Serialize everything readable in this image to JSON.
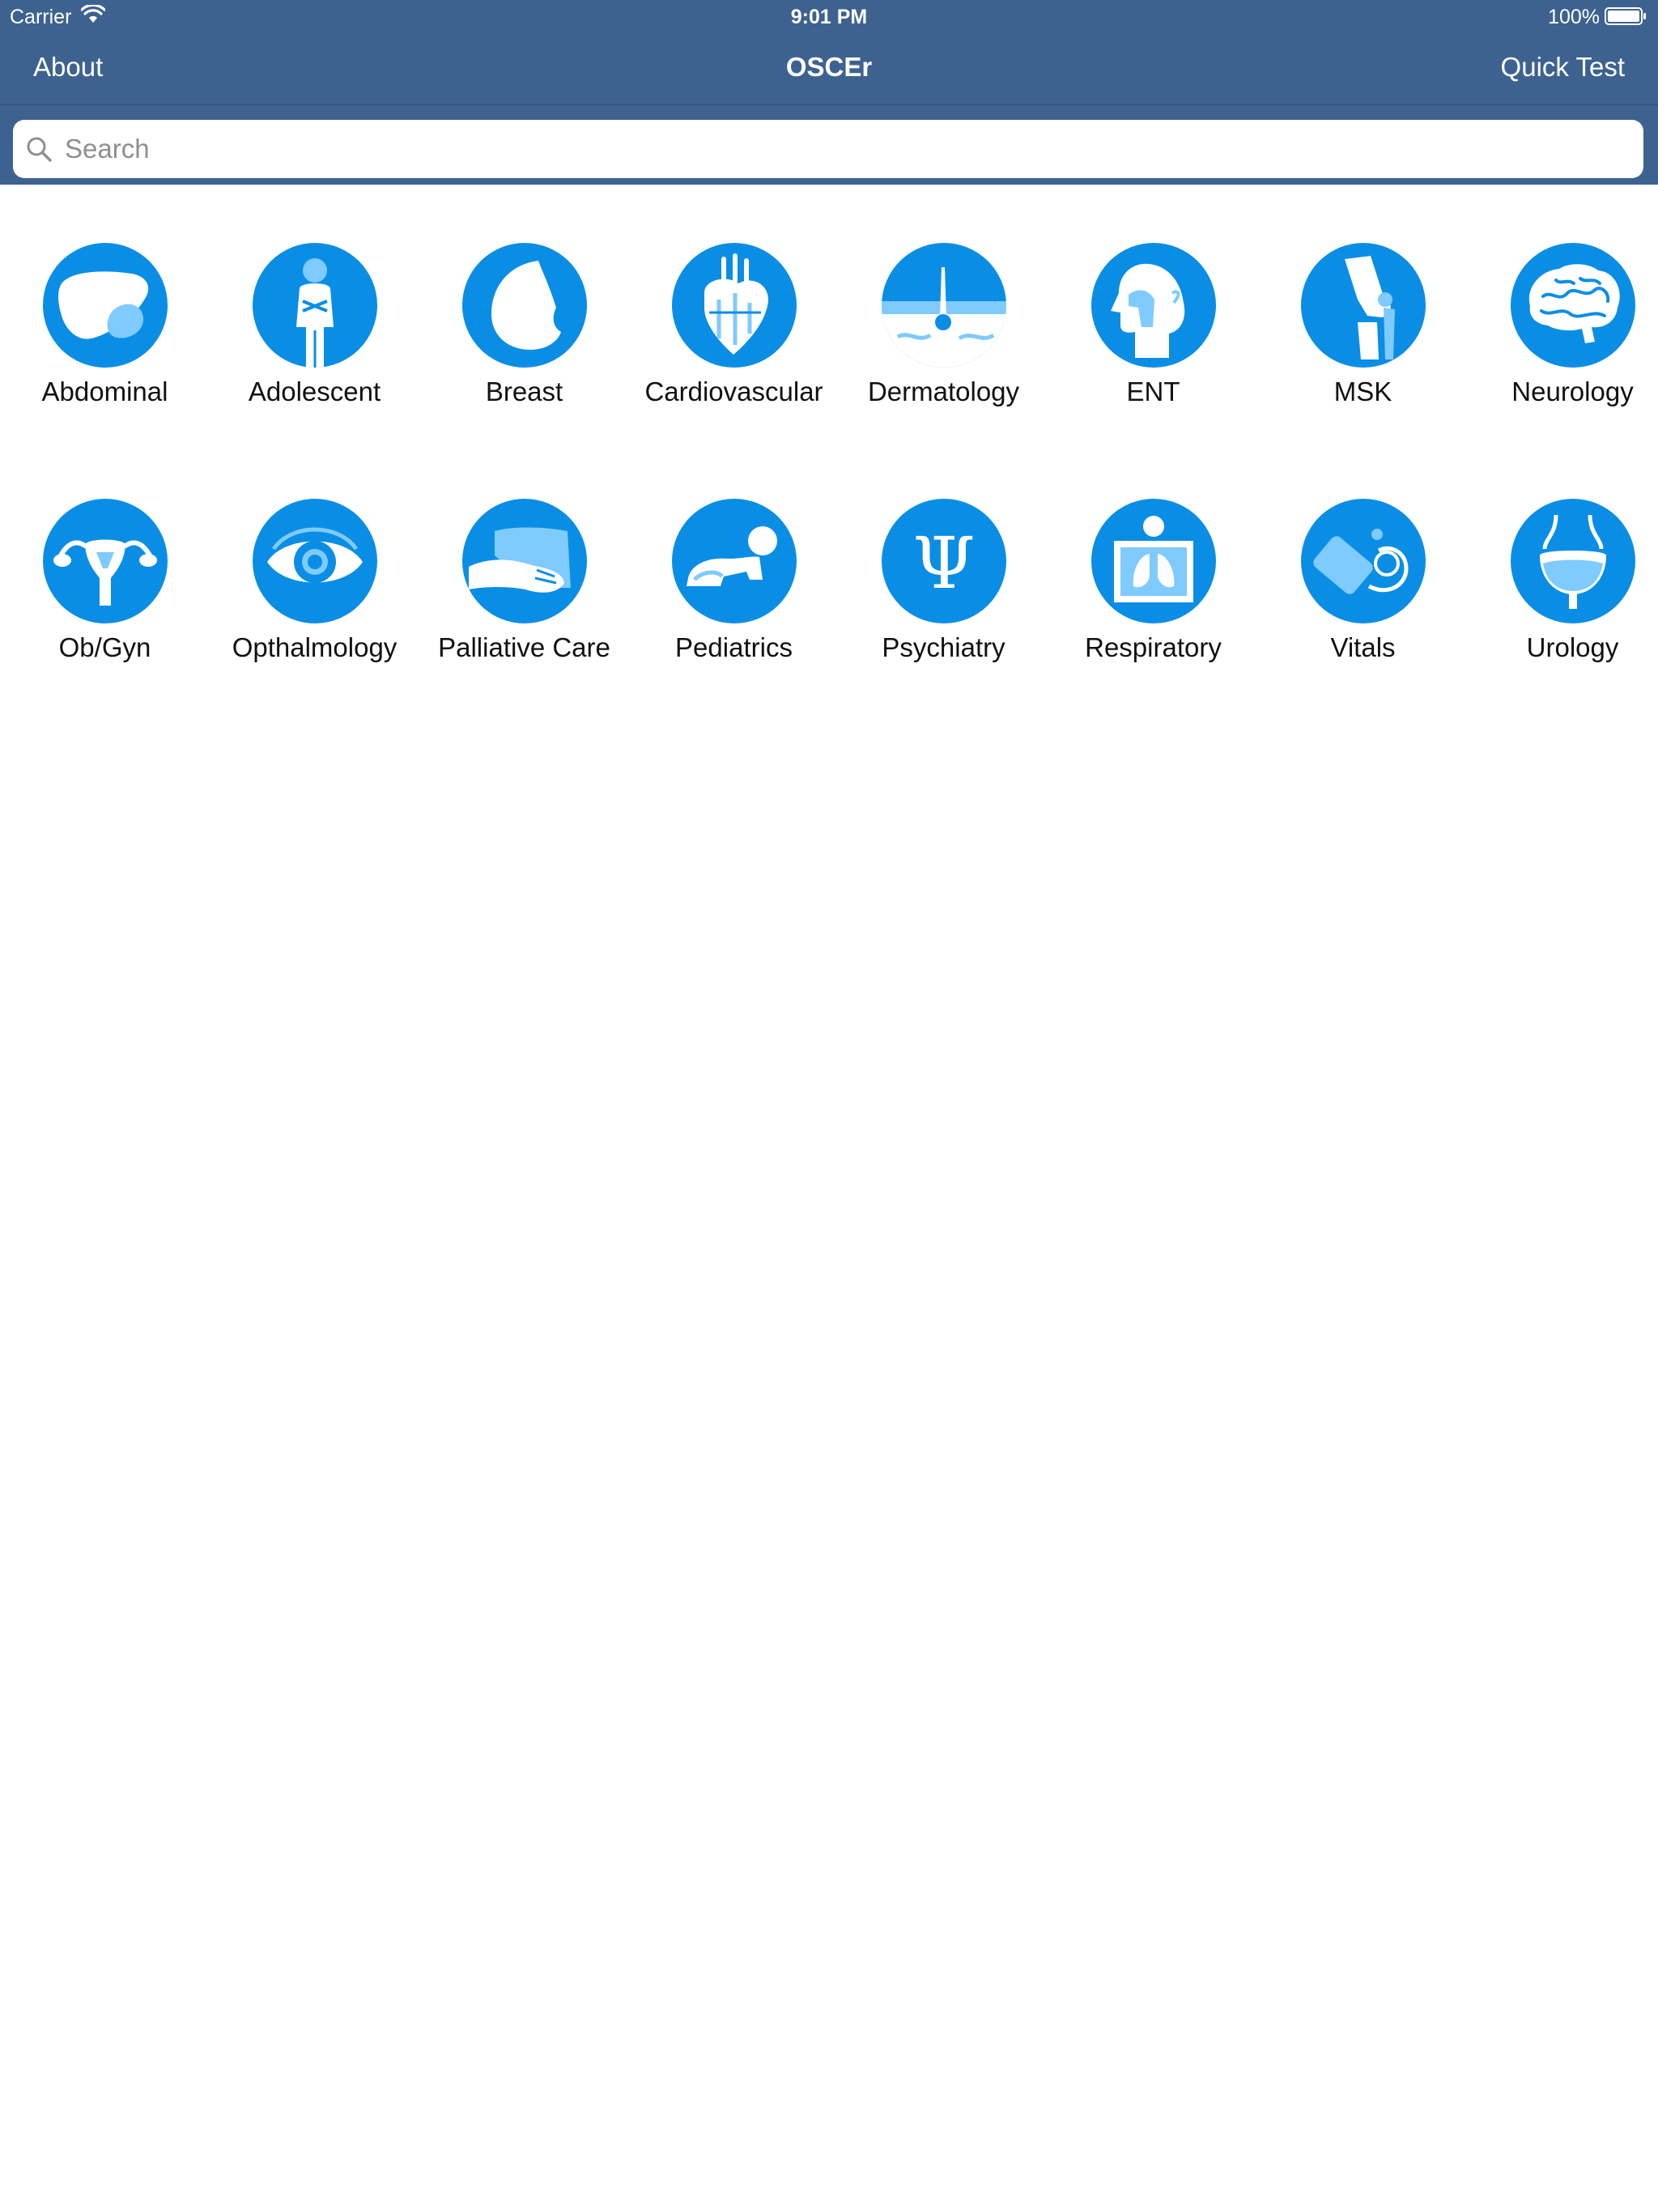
{
  "status": {
    "carrier": "Carrier",
    "time": "9:01 PM",
    "battery": "100%"
  },
  "nav": {
    "left": "About",
    "title": "OSCEr",
    "right": "Quick Test"
  },
  "search": {
    "placeholder": "Search"
  },
  "colors": {
    "navbar": "#3d6290",
    "icon_circle": "#0a8ee5",
    "icon_light": "#7fcaff",
    "icon_white": "#ffffff"
  },
  "categories": [
    {
      "label": "Abdominal",
      "icon": "liver-icon"
    },
    {
      "label": "Adolescent",
      "icon": "adolescent-icon"
    },
    {
      "label": "Breast",
      "icon": "breast-icon"
    },
    {
      "label": "Cardiovascular",
      "icon": "heart-icon"
    },
    {
      "label": "Dermatology",
      "icon": "skin-icon"
    },
    {
      "label": "ENT",
      "icon": "head-profile-icon"
    },
    {
      "label": "MSK",
      "icon": "knee-joint-icon"
    },
    {
      "label": "Neurology",
      "icon": "brain-icon"
    },
    {
      "label": "Ob/Gyn",
      "icon": "uterus-icon"
    },
    {
      "label": "Opthalmology",
      "icon": "eye-icon"
    },
    {
      "label": "Palliative Care",
      "icon": "hands-icon"
    },
    {
      "label": "Pediatrics",
      "icon": "crawling-baby-icon"
    },
    {
      "label": "Psychiatry",
      "icon": "psi-icon"
    },
    {
      "label": "Respiratory",
      "icon": "lungs-xray-icon"
    },
    {
      "label": "Vitals",
      "icon": "blood-pressure-cuff-icon"
    },
    {
      "label": "Urology",
      "icon": "bladder-icon"
    }
  ]
}
